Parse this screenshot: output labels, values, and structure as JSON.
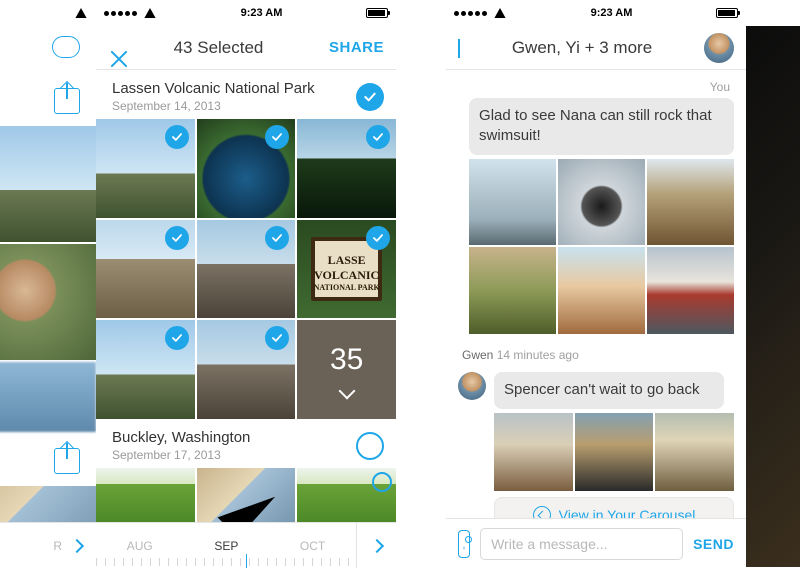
{
  "status": {
    "time": "9:23 AM"
  },
  "selection": {
    "title": "43 Selected",
    "share": "SHARE",
    "sections": [
      {
        "place": "Lassen Volcanic National Park",
        "date": "September 14, 2013",
        "all_selected": true,
        "sign_line1": "LASSE",
        "sign_line2": "VOLCANIC",
        "sign_line3": "NATIONAL PARK",
        "overflow_count": "35"
      },
      {
        "place": "Buckley, Washington",
        "date": "September 17, 2013",
        "all_selected": false
      }
    ],
    "timeline": {
      "months": [
        "AUG",
        "SEP",
        "OCT"
      ],
      "active": "SEP"
    },
    "left_partial_month": "R"
  },
  "chat": {
    "title": "Gwen, Yi + 3 more",
    "self_label": "You",
    "sent_text": "Glad to see Nana can still rock that swimsuit!",
    "received": {
      "sender": "Gwen",
      "age": "14 minutes ago",
      "text": "Spencer can't wait to go back"
    },
    "view_label": "View in Your Carousel",
    "input_placeholder": "Write a message...",
    "send_label": "SEND"
  }
}
